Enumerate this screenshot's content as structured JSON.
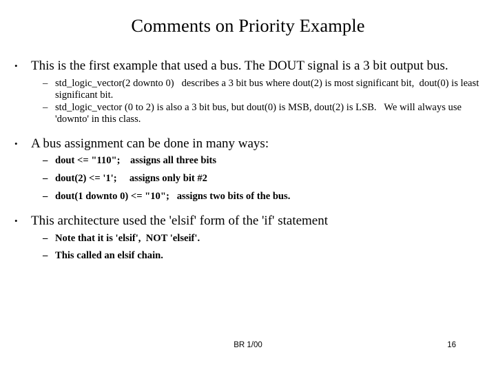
{
  "slide": {
    "title": "Comments on Priority Example",
    "bullet_marker": "•",
    "dash_marker": "–",
    "blocks": [
      {
        "level1": "This is the first example that used a bus.  The DOUT signal is a 3 bit output bus.",
        "sub": [
          {
            "text": "std_logic_vector(2 downto 0)   describes a 3 bit bus where dout(2) is most significant bit,  dout(0) is least significant bit.",
            "bold": false
          },
          {
            "text": "std_logic_vector (0 to 2) is also a 3 bit bus, but dout(0) is MSB, dout(2) is LSB.   We will always use 'downto' in this class.",
            "bold": false
          }
        ]
      },
      {
        "level1": "A bus assignment can be done in many ways:",
        "sub": [
          {
            "text": "dout <= \"110\";    assigns all three bits",
            "bold": true
          },
          {
            "text": "dout(2) <= '1';     assigns only bit #2",
            "bold": true
          },
          {
            "text": "dout(1 downto 0) <= \"10\";   assigns two bits of the bus.",
            "bold": true
          }
        ]
      },
      {
        "level1": "This architecture used the 'elsif' form of the 'if' statement",
        "sub": [
          {
            "text": "Note that it is 'elsif',  NOT 'elseif'.",
            "bold": true
          },
          {
            "text": "This called an elsif chain.",
            "bold": true
          }
        ]
      }
    ]
  },
  "footer": {
    "center_text": "BR 1/00",
    "page_number": "16"
  },
  "colors": {
    "background": "#ffffff",
    "text": "#000000"
  }
}
